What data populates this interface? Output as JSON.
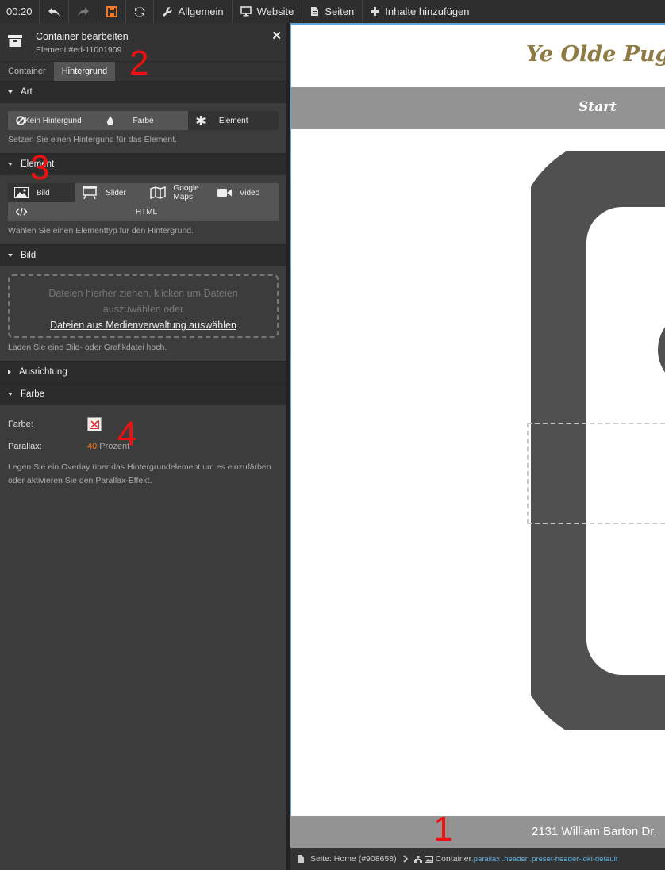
{
  "toolbar": {
    "time": "00:20",
    "undo_icon": "undo-icon",
    "redo_icon": "redo-icon",
    "save_icon": "save-icon",
    "refresh_icon": "refresh-icon",
    "general_label": "Allgemein",
    "website_label": "Website",
    "pages_label": "Seiten",
    "add_content_label": "Inhalte hinzufügen",
    "save_color": "#f07b2a"
  },
  "panel": {
    "title": "Container bearbeiten",
    "subtitle": "Element #ed-11001909",
    "tabs": [
      "Container",
      "Hintergrund"
    ],
    "sections": {
      "art": {
        "label": "Art",
        "options": [
          "Kein Hintergund",
          "Farbe",
          "Element"
        ],
        "help": "Setzen Sie einen Hintergund für das Element."
      },
      "element": {
        "label": "Element",
        "options": [
          "Bild",
          "Slider",
          "Google Maps",
          "Video",
          "HTML"
        ],
        "help": "Wählen Sie einen Elementtyp für den Hintergrund."
      },
      "bild": {
        "label": "Bild",
        "drop_text": "Dateien hierher ziehen, klicken um Dateien auszuwählen oder",
        "drop_link": "Dateien aus Medienverwaltung auswählen",
        "help": "Laden Sie eine Bild- oder Grafikdatei hoch."
      },
      "ausrichtung": {
        "label": "Ausrichtung"
      },
      "farbe": {
        "label": "Farbe",
        "color_label": "Farbe:",
        "parallax_label": "Parallax:",
        "parallax_value": "40",
        "parallax_unit": "Prozent",
        "help": "Legen Sie ein Overlay über das Hintergrundelement um es einzufärben oder aktivieren Sie den Parallax-Effekt."
      }
    }
  },
  "preview": {
    "site_title": "Ye Olde Pug C",
    "nav_item": "Start",
    "footer_text": "2131 William Barton Dr,"
  },
  "statusbar": {
    "page": "Seite: Home (#908658)",
    "container": "Container",
    "classes": ".parallax .header .preset-header-loki-default"
  },
  "annotations": [
    "1",
    "2",
    "3",
    "4"
  ]
}
